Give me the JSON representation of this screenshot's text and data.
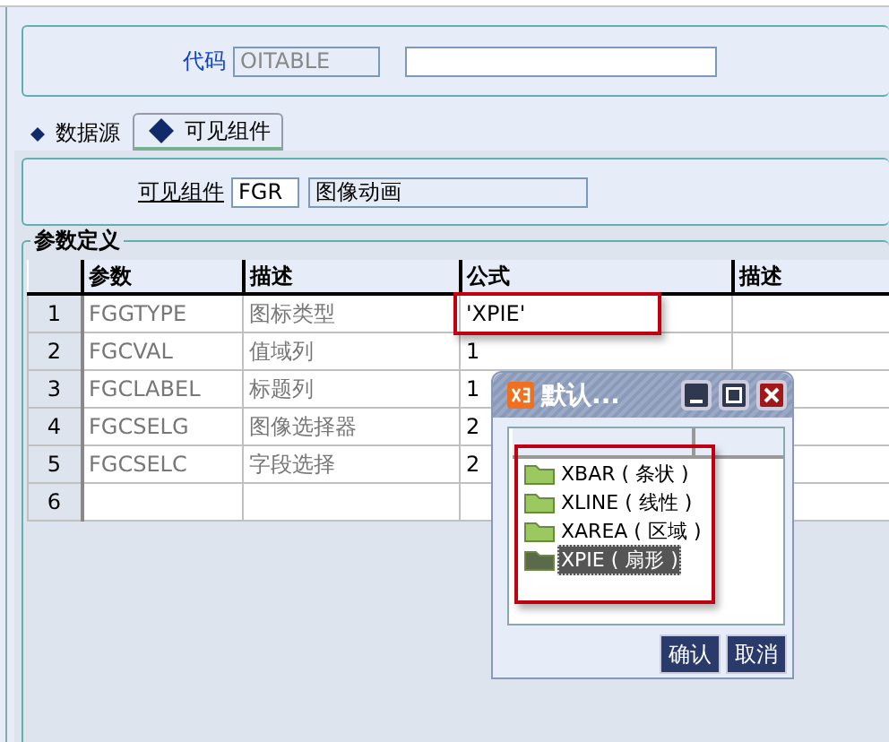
{
  "code_field": {
    "label": "代码",
    "value": "OITABLE"
  },
  "tabs": [
    {
      "label": "数据源",
      "selected": false
    },
    {
      "label": "可见组件",
      "selected": true
    }
  ],
  "component": {
    "label": "可见组件",
    "code": "FGR",
    "name": "图像动画"
  },
  "params": {
    "title": "参数定义",
    "columns": [
      "参数",
      "描述",
      "公式",
      "描述"
    ],
    "rows": [
      {
        "number": "1",
        "param": "FGGTYPE",
        "desc": "图标类型",
        "formula": "'XPIE'"
      },
      {
        "number": "2",
        "param": "FGCVAL",
        "desc": "值域列",
        "formula": "1"
      },
      {
        "number": "3",
        "param": "FGCLABEL",
        "desc": "标题列",
        "formula": "1"
      },
      {
        "number": "4",
        "param": "FGCSELG",
        "desc": "图像选择器",
        "formula": "2"
      },
      {
        "number": "5",
        "param": "FGCSELC",
        "desc": "字段选择",
        "formula": "2"
      },
      {
        "number": "6"
      }
    ]
  },
  "dialog": {
    "title": "默认...",
    "items": [
      {
        "label": "XBAR ( 条状 )",
        "selected": false
      },
      {
        "label": "XLINE ( 线性 )",
        "selected": false
      },
      {
        "label": "XAREA ( 区域 )",
        "selected": false
      },
      {
        "label": "XPIE ( 扇形 )",
        "selected": true
      }
    ],
    "buttons": [
      "确认",
      "取消"
    ]
  }
}
